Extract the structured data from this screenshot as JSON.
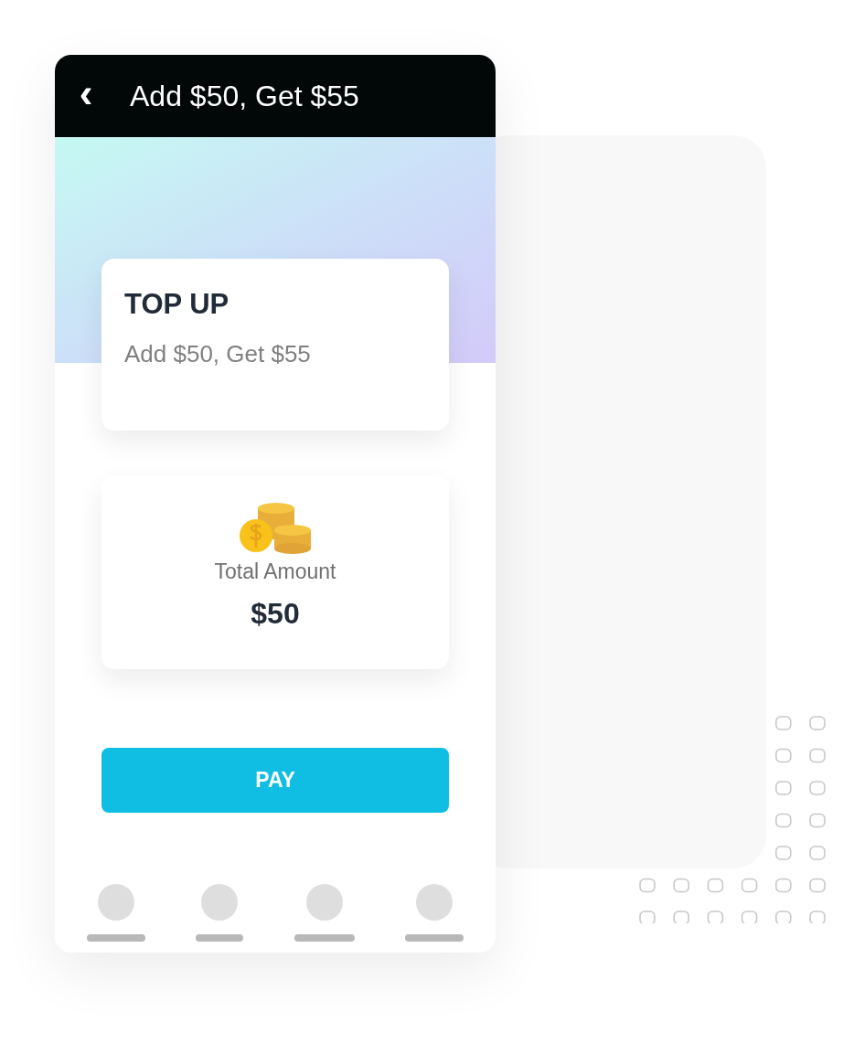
{
  "header": {
    "back_icon": "‹",
    "title": "Add $50, Get $55"
  },
  "offer_card": {
    "heading": "TOP UP",
    "description": "Add $50, Get $55"
  },
  "amount_card": {
    "label": "Total Amount",
    "amount": "$50"
  },
  "pay_button": {
    "label": "PAY"
  }
}
